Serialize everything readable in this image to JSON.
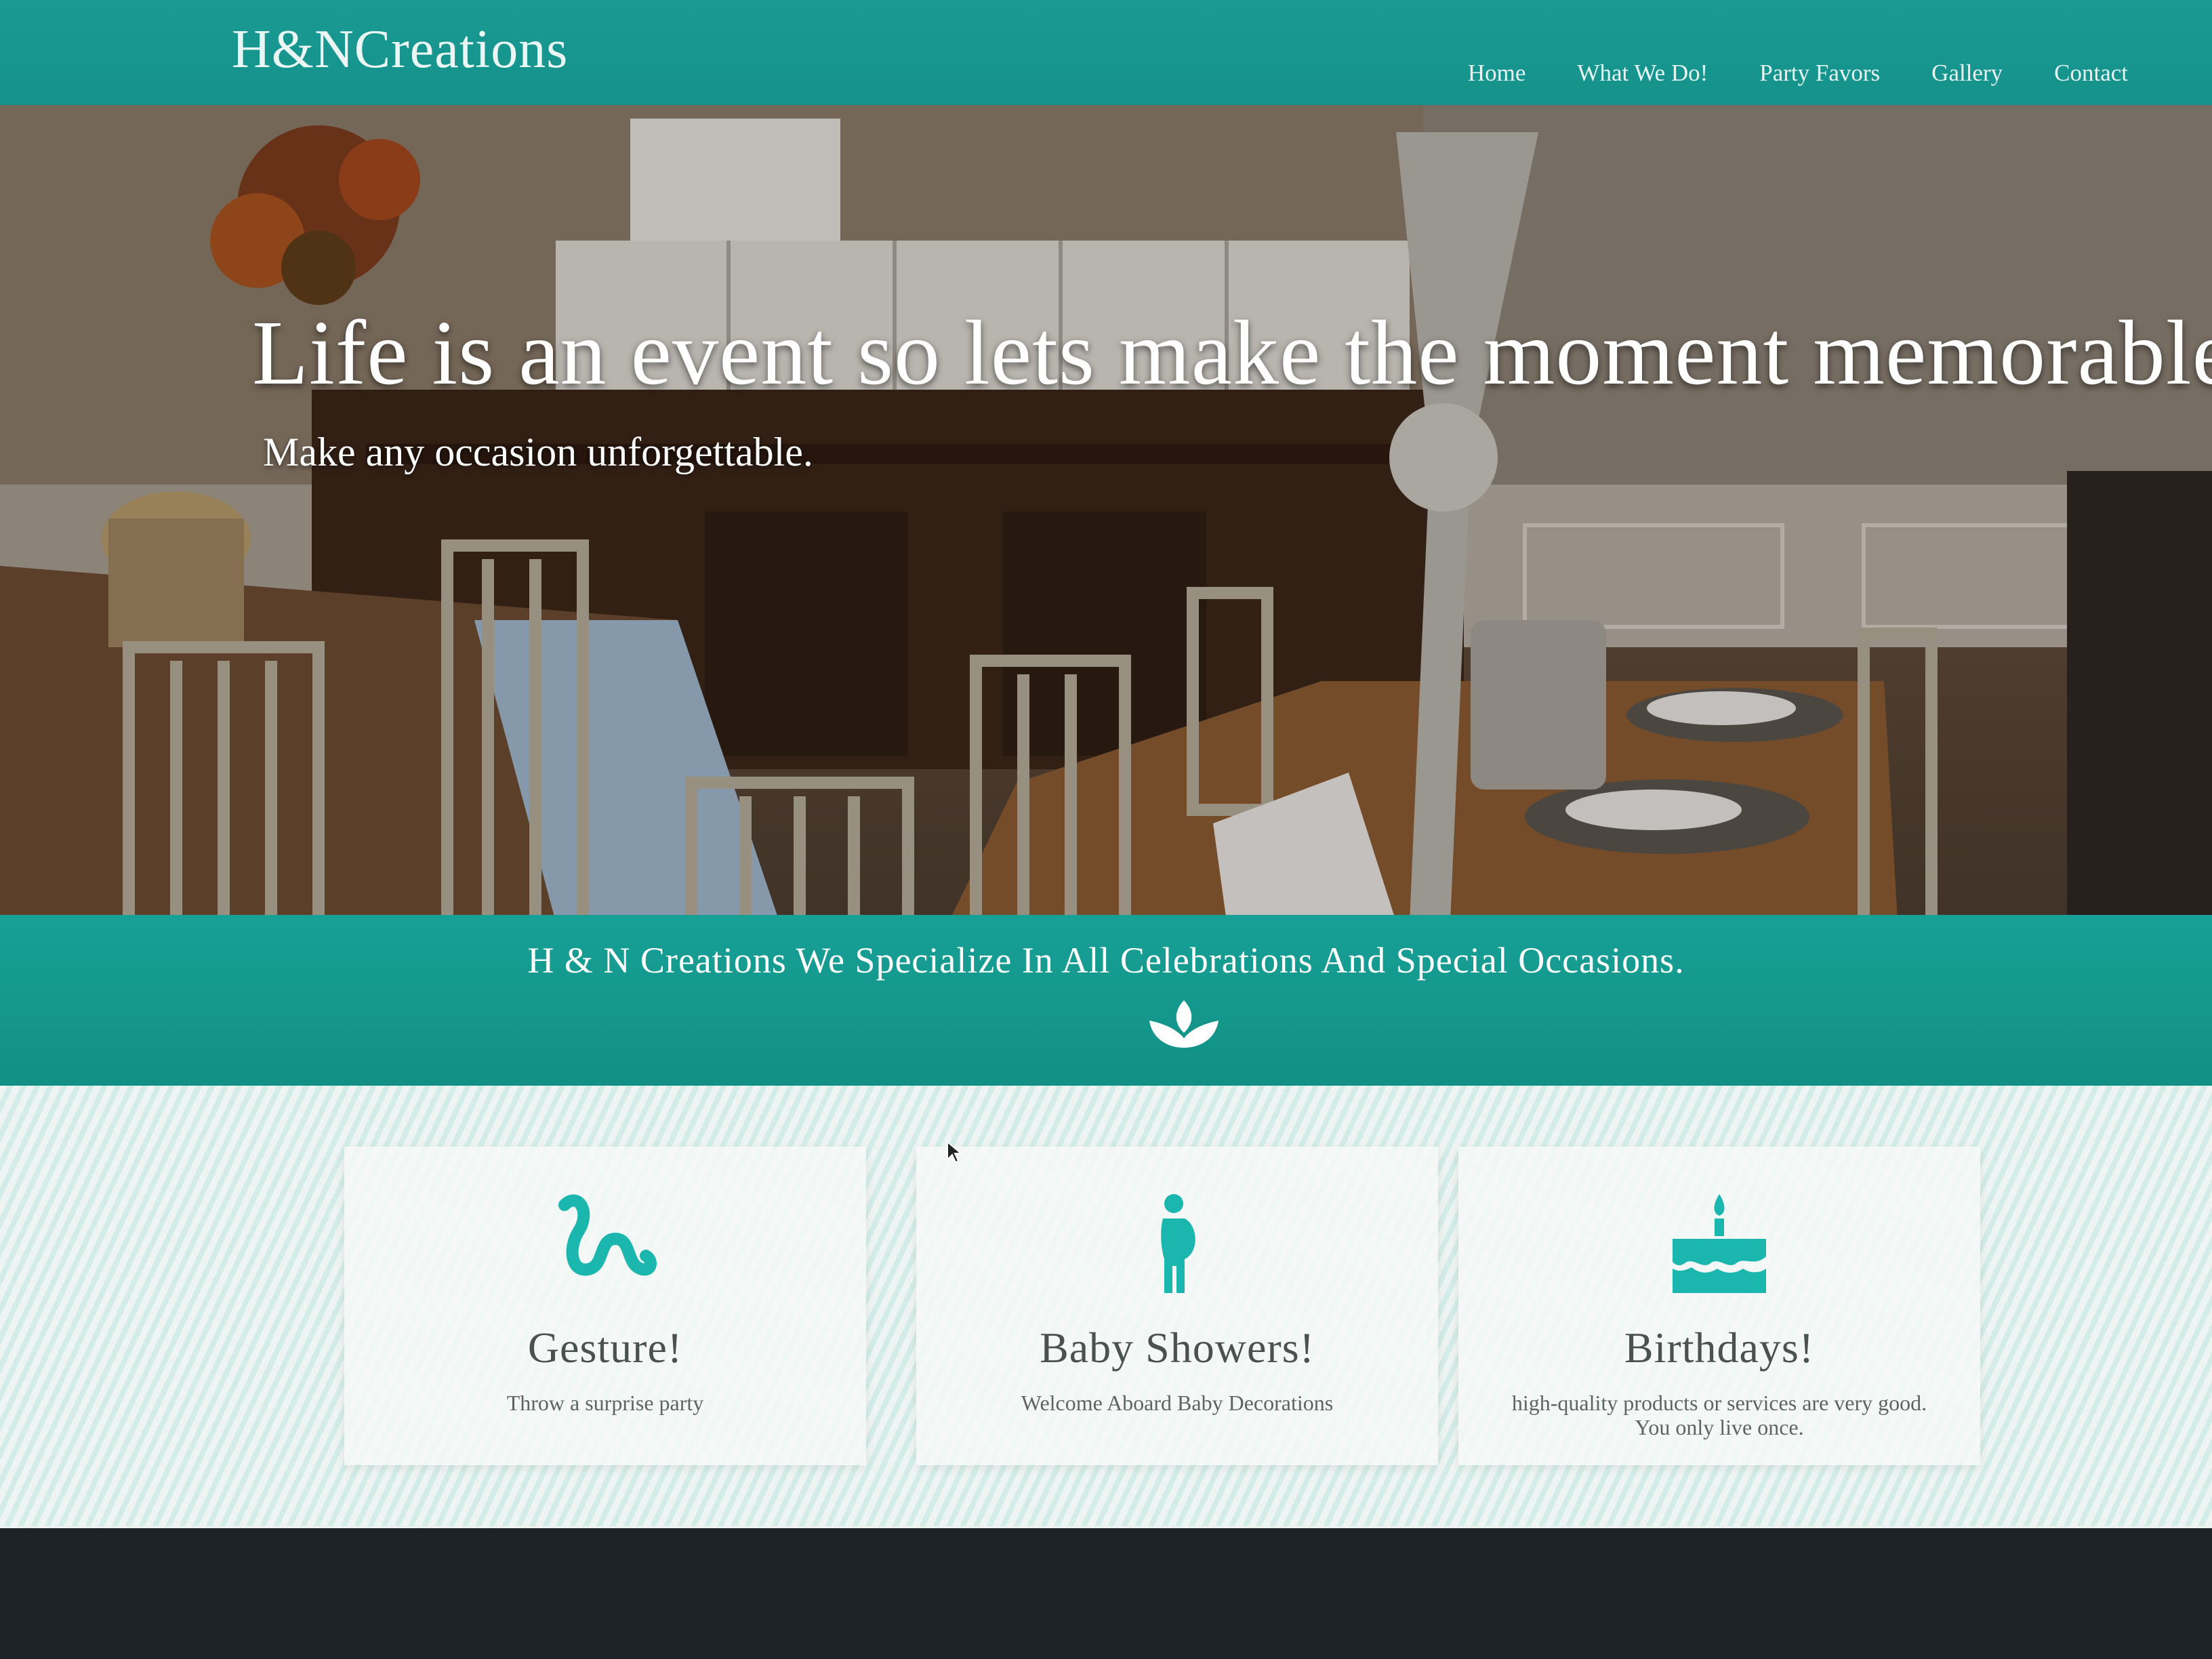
{
  "brand": {
    "name": "H&NCreations"
  },
  "nav": {
    "items": [
      {
        "label": "Home"
      },
      {
        "label": "What We Do!"
      },
      {
        "label": "Party Favors"
      },
      {
        "label": "Gallery"
      },
      {
        "label": "Contact"
      }
    ]
  },
  "hero": {
    "title": "Life is an event so lets make the moment memorable.",
    "subtitle": "Make any occasion unforgettable."
  },
  "band": {
    "text": "H & N Creations We Specialize In All Celebrations And Special Occasions.",
    "icon": "lotus-icon"
  },
  "services": [
    {
      "icon": "gesture-icon",
      "title": "Gesture!",
      "description": "Throw a surprise party"
    },
    {
      "icon": "pregnant-woman-icon",
      "title": "Baby Showers!",
      "description": "Welcome Aboard Baby Decorations"
    },
    {
      "icon": "birthday-cake-icon",
      "title": "Birthdays!",
      "description": "high-quality products or services are very good. You only live once."
    }
  ],
  "colors": {
    "teal": "#139089",
    "accent_icon": "#1bb7ae",
    "text_dark": "#4b5150"
  }
}
